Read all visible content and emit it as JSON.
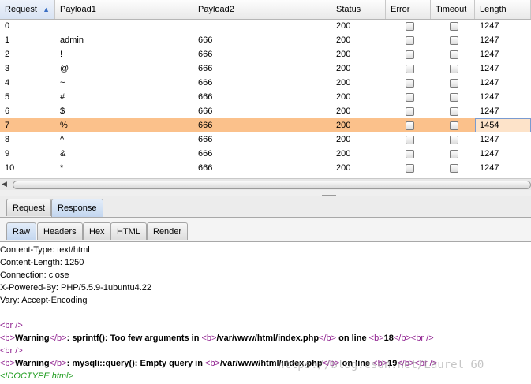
{
  "table": {
    "columns": [
      {
        "label": "Request",
        "sorted": "asc"
      },
      {
        "label": "Payload1"
      },
      {
        "label": "Payload2"
      },
      {
        "label": "Status"
      },
      {
        "label": "Error"
      },
      {
        "label": "Timeout"
      },
      {
        "label": "Length"
      }
    ],
    "sort_arrow": "▲",
    "rows": [
      {
        "request": "0",
        "payload1": "",
        "payload2": "",
        "status": "200",
        "length": "1247"
      },
      {
        "request": "1",
        "payload1": "admin",
        "payload2": "666",
        "status": "200",
        "length": "1247"
      },
      {
        "request": "2",
        "payload1": "!",
        "payload2": "666",
        "status": "200",
        "length": "1247"
      },
      {
        "request": "3",
        "payload1": "@",
        "payload2": "666",
        "status": "200",
        "length": "1247"
      },
      {
        "request": "4",
        "payload1": "~",
        "payload2": "666",
        "status": "200",
        "length": "1247"
      },
      {
        "request": "5",
        "payload1": "#",
        "payload2": "666",
        "status": "200",
        "length": "1247"
      },
      {
        "request": "6",
        "payload1": "$",
        "payload2": "666",
        "status": "200",
        "length": "1247"
      },
      {
        "request": "7",
        "payload1": "%",
        "payload2": "666",
        "status": "200",
        "length": "1454",
        "highlighted": true
      },
      {
        "request": "8",
        "payload1": "^",
        "payload2": "666",
        "status": "200",
        "length": "1247"
      },
      {
        "request": "9",
        "payload1": "&",
        "payload2": "666",
        "status": "200",
        "length": "1247"
      },
      {
        "request": "10",
        "payload1": "*",
        "payload2": "666",
        "status": "200",
        "length": "1247"
      }
    ],
    "highlight_color": "#fbc18b"
  },
  "scrollbar": {
    "left_arrow": "◀"
  },
  "outer_tabs": {
    "request": "Request",
    "response": "Response",
    "active": "Response"
  },
  "inner_tabs": {
    "raw": "Raw",
    "headers": "Headers",
    "hex": "Hex",
    "html": "HTML",
    "render": "Render",
    "active": "Raw"
  },
  "response": {
    "headers": [
      "Content-Type: text/html",
      "Content-Length: 1250",
      "Connection: close",
      "X-Powered-By: PHP/5.5.9-1ubuntu4.22",
      "Vary: Accept-Encoding"
    ],
    "br_tag": "<br />",
    "b_open": "<b>",
    "b_close": "</b>",
    "br_open": "<br",
    "br_close_tail": " />",
    "warning_word": "Warning",
    "warn1_msg": ":  sprintf(): Too few arguments in ",
    "warn1_path": "/var/www/html/index.php",
    "on_line": " on line ",
    "warn1_line": "18",
    "warn2_msg": ":  mysqli::query(): Empty query in ",
    "warn2_path": "/var/www/html/index.php",
    "warn2_line": "19",
    "doctype": "<!DOCTYPE html>"
  },
  "watermark": "https://blog.csdn.net/Laurel_60"
}
